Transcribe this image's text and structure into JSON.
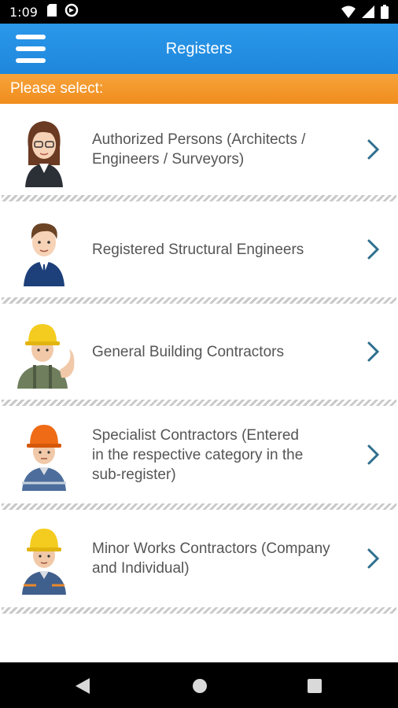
{
  "status_bar": {
    "time": "1:09",
    "icons": [
      "sd-card-icon",
      "sync-icon",
      "wifi-icon",
      "signal-icon",
      "battery-icon"
    ]
  },
  "app_bar": {
    "title": "Registers",
    "menu_icon": "hamburger-menu-icon",
    "background": "#2196e8"
  },
  "prompt": {
    "text": "Please select:",
    "background": "#f39a2b"
  },
  "items": [
    {
      "label_line1": "Authorized Persons (Architects /",
      "label_line2": "Engineers / Surveyors)",
      "label_line3": "",
      "avatar": "female-professional-avatar"
    },
    {
      "label_line1": "Registered Structural Engineers",
      "label_line2": "",
      "label_line3": "",
      "avatar": "male-engineer-avatar"
    },
    {
      "label_line1": "General Building Contractors",
      "label_line2": "",
      "label_line3": "",
      "avatar": "yellow-helmet-worker-avatar"
    },
    {
      "label_line1": "Specialist Contractors (Entered",
      "label_line2": "in the respective category in the",
      "label_line3": "sub-register)",
      "avatar": "orange-helmet-worker-avatar"
    },
    {
      "label_line1": "Minor Works Contractors (Company",
      "label_line2": "and Individual)",
      "label_line3": "",
      "avatar": "yellow-helmet-technician-avatar"
    }
  ],
  "nav_bar": {
    "buttons": [
      "back-icon",
      "home-icon",
      "recents-icon"
    ]
  },
  "colors": {
    "chevron": "#2e6f8e",
    "label": "#555555"
  }
}
